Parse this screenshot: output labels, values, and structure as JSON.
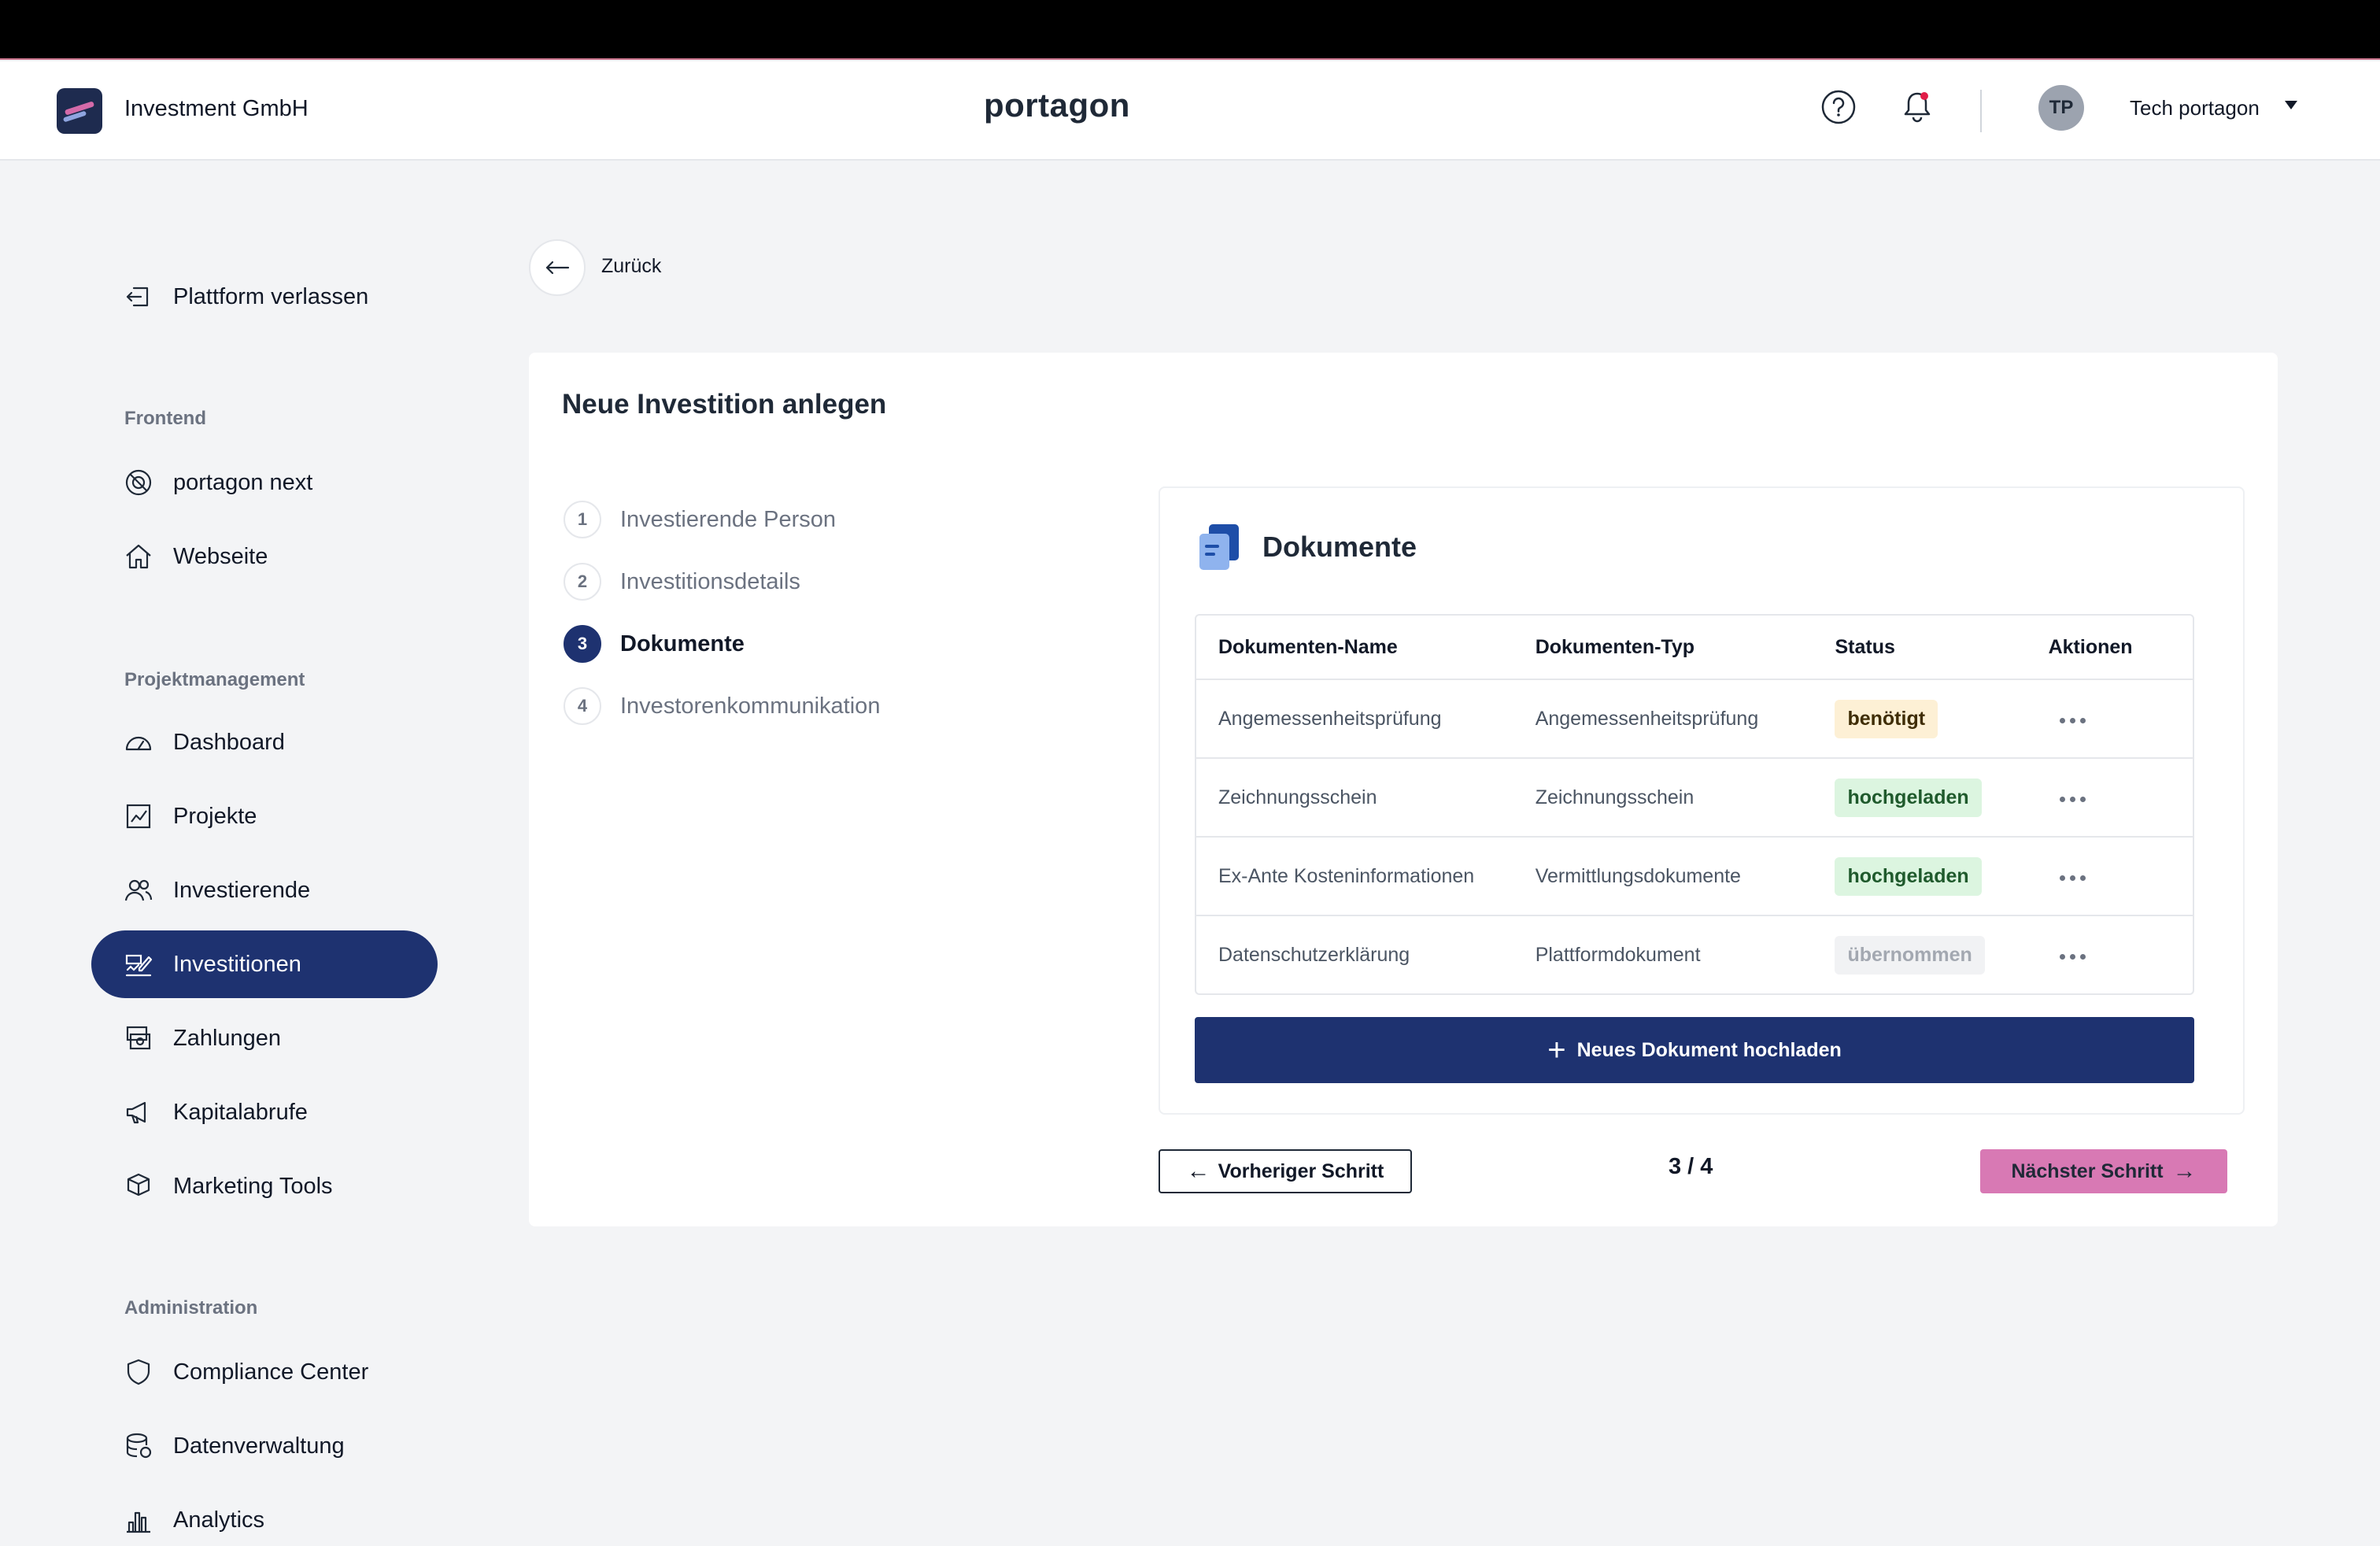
{
  "header": {
    "company_name": "Investment GmbH",
    "brand": "portagon",
    "user_initials": "TP",
    "user_name": "Tech portagon"
  },
  "sidebar": {
    "leave_platform": "Plattform verlassen",
    "sections": [
      {
        "title": "Frontend",
        "items": [
          {
            "label": "portagon next",
            "icon": "globe-icon"
          },
          {
            "label": "Webseite",
            "icon": "home-icon"
          }
        ]
      },
      {
        "title": "Projektmanagement",
        "items": [
          {
            "label": "Dashboard",
            "icon": "gauge-icon"
          },
          {
            "label": "Projekte",
            "icon": "chart-icon"
          },
          {
            "label": "Investierende",
            "icon": "users-icon"
          },
          {
            "label": "Investitionen",
            "icon": "signature-icon",
            "active": true
          },
          {
            "label": "Zahlungen",
            "icon": "payments-icon"
          },
          {
            "label": "Kapitalabrufe",
            "icon": "megaphone-icon"
          },
          {
            "label": "Marketing Tools",
            "icon": "boxes-icon"
          }
        ]
      },
      {
        "title": "Administration",
        "items": [
          {
            "label": "Compliance Center",
            "icon": "shield-icon"
          },
          {
            "label": "Datenverwaltung",
            "icon": "database-icon"
          },
          {
            "label": "Analytics",
            "icon": "bar-chart-icon"
          }
        ]
      }
    ]
  },
  "back_label": "Zurück",
  "card": {
    "title": "Neue Investition anlegen",
    "steps": [
      {
        "num": "1",
        "label": "Investierende Person"
      },
      {
        "num": "2",
        "label": "Investitionsdetails"
      },
      {
        "num": "3",
        "label": "Dokumente",
        "active": true
      },
      {
        "num": "4",
        "label": "Investorenkommunikation"
      }
    ],
    "documents": {
      "title": "Dokumente",
      "columns": [
        "Dokumenten-Name",
        "Dokumenten-Typ",
        "Status",
        "Aktionen"
      ],
      "rows": [
        {
          "name": "Angemessenheitsprüfung",
          "type": "Angemessenheitsprüfung",
          "status": "benötigt",
          "status_kind": "required"
        },
        {
          "name": "Zeichnungsschein",
          "type": "Zeichnungsschein",
          "status": "hochgeladen",
          "status_kind": "uploaded"
        },
        {
          "name": "Ex-Ante Kosteninformationen",
          "type": "Vermittlungsdokumente",
          "status": "hochgeladen",
          "status_kind": "uploaded"
        },
        {
          "name": "Datenschutzerklärung",
          "type": "Plattformdokument",
          "status": "übernommen",
          "status_kind": "adopted"
        }
      ],
      "upload_label": "Neues Dokument hochladen"
    },
    "prev_label": "Vorheriger Schritt",
    "step_counter": "3 / 4",
    "next_label": "Nächster Schritt"
  },
  "colors": {
    "primary": "#1e3270",
    "accent_pink": "#d879b4",
    "badge_required_bg": "#fdf0d5",
    "badge_required_fg": "#3f2d05",
    "badge_uploaded_bg": "#dcf5e0",
    "badge_uploaded_fg": "#1f5a2c",
    "badge_adopted_bg": "#f1f2f4",
    "badge_adopted_fg": "#a3a8b1"
  }
}
